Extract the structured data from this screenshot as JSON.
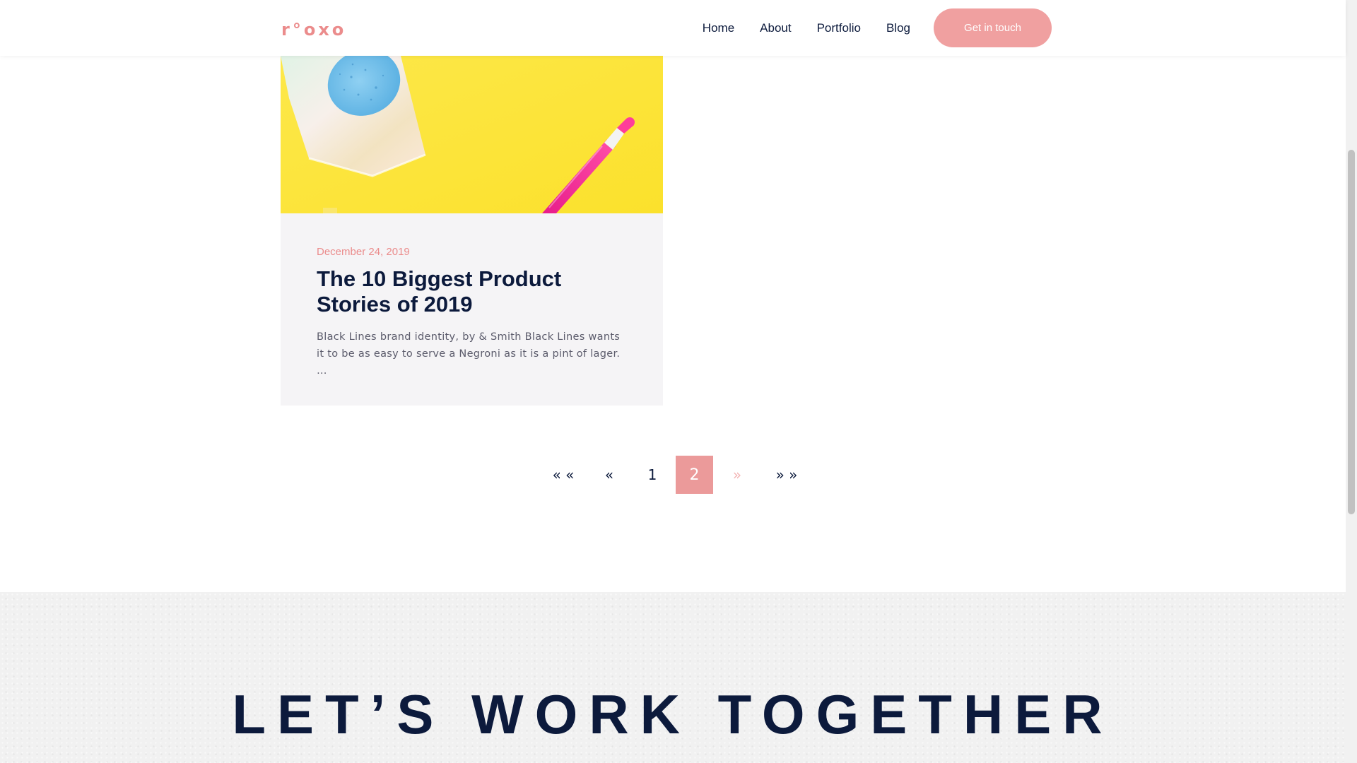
{
  "header": {
    "logo_text": "r°oxo",
    "nav": [
      "Home",
      "About",
      "Portfolio",
      "Blog"
    ],
    "cta_label": "Get in touch"
  },
  "post": {
    "date": "December 24, 2019",
    "title": "The 10 Biggest Product Stories of 2019",
    "excerpt": "Black Lines brand identity, by & Smith Black Lines wants it to be as easy to serve a Negroni as it is a pint of lager. …"
  },
  "pagination": {
    "first": "« «",
    "prev": "«",
    "page1": "1",
    "page2": "2",
    "next": "»",
    "last": "» »",
    "current_page": 2
  },
  "footer_cta": {
    "heading": "LET’S WORK TOGETHER"
  },
  "colors": {
    "accent": "#eb9a9a",
    "navy": "#0c1a3c",
    "card_bg": "#f5f4f6",
    "image_yellow": "#fde63a"
  },
  "icons": [
    "sponge-packet-illustration",
    "pink-pen-illustration"
  ]
}
